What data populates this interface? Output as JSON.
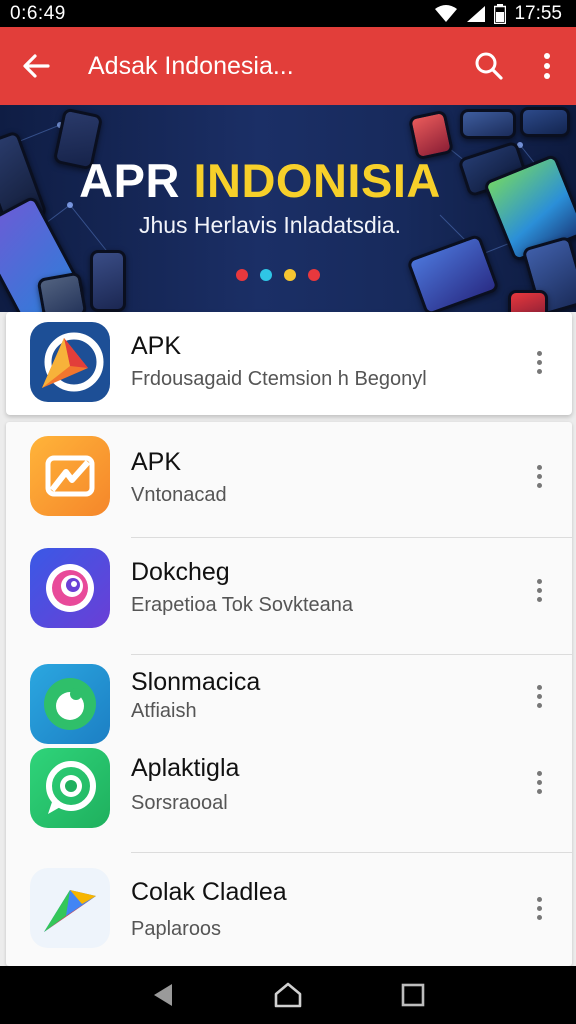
{
  "status_bar": {
    "time": "0:6:49",
    "clock": "17:55"
  },
  "app_bar": {
    "title": "Adsak Indonesia..."
  },
  "banner": {
    "title_part1": "APR ",
    "title_part2": "INDONISIA",
    "subtitle": "Jhus Herlavis Inladatsdia.",
    "dot_colors": [
      "#e8383d",
      "#2fc6e6",
      "#f5c531",
      "#e8383d"
    ]
  },
  "apps": [
    {
      "name": "APK",
      "description": "Frdousagaid Ctemsion h Begonyl",
      "icon": "apk-arrow-logo"
    },
    {
      "name": "APK",
      "description": "Vntonacad",
      "icon": "lightning-logo"
    },
    {
      "name": "Dokcheg",
      "description": "Erapetioa Tok Sovkteana",
      "icon": "swirl-logo"
    },
    {
      "name": "Slonmacica",
      "description": "Atfiaish",
      "icon": "green-bubble-logo"
    },
    {
      "name": "Aplaktigla",
      "description": "Sorsraooal",
      "icon": "chat-bubble-logo"
    },
    {
      "name": "Colak Cladlea",
      "description": "Paplaroos",
      "icon": "play-triangle-logo"
    }
  ],
  "colors": {
    "accent": "#e23e3a",
    "banner_bg": "#17295a",
    "banner_highlight": "#f7d02a"
  }
}
